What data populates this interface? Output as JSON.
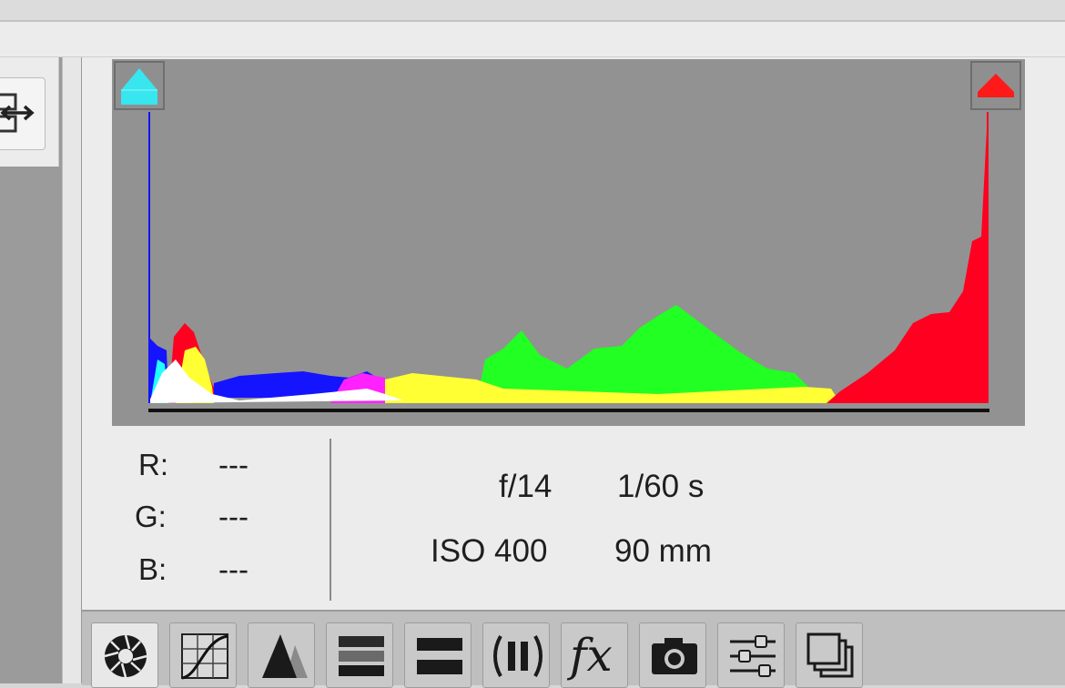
{
  "histogram": {
    "shadow_clipping_color": "#37e6ee",
    "highlight_clipping_color": "#ff1a1a",
    "colors": {
      "red": "#ff0020",
      "green": "#22ff22",
      "blue": "#1414ff",
      "yellow": "#ffff33",
      "magenta": "#ff22ff",
      "cyan": "#22ffff",
      "white": "#ffffff",
      "background": "#929292"
    }
  },
  "readout": {
    "r_label": "R:",
    "g_label": "G:",
    "b_label": "B:",
    "r_value": "---",
    "g_value": "---",
    "b_value": "---"
  },
  "camera": {
    "aperture": "f/14",
    "shutter": "1/60 s",
    "iso": "ISO 400",
    "focal_length": "90 mm"
  },
  "toolbar": {
    "tools": [
      "basic-icon",
      "tone-curve-icon",
      "detail-icon",
      "hsl-icon",
      "split-toning-icon",
      "lens-corrections-icon",
      "effects-icon",
      "camera-calibration-icon",
      "presets-icon",
      "snapshots-icon"
    ],
    "effects_glyph": "fx",
    "active_tool": "basic-icon"
  }
}
